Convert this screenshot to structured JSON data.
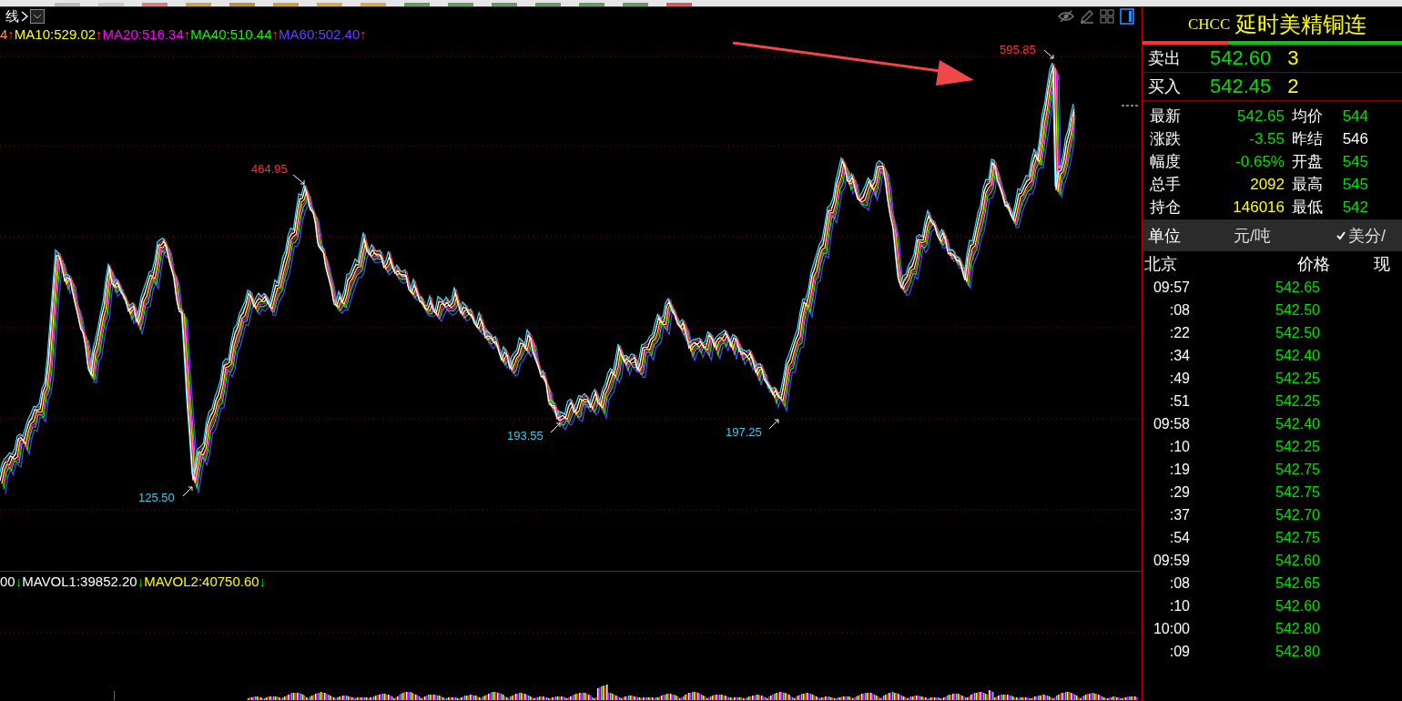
{
  "chart": {
    "period_label": "线",
    "ma_legend": [
      {
        "value": "4",
        "color": "#ff9a30",
        "arrow": "↑",
        "rising": true
      },
      {
        "value": "MA10:529.02",
        "color": "#ffff00",
        "arrow": "↑",
        "rising": true
      },
      {
        "value": "MA20:516.34",
        "color": "#ff00ff",
        "arrow": "↑",
        "rising": true
      },
      {
        "value": "MA40:510.44",
        "color": "#00ff00",
        "arrow": "↑",
        "rising": true
      },
      {
        "value": "MA60:502.40",
        "color": "#6a3cff",
        "arrow": "↑",
        "rising": true
      }
    ],
    "peak_labels": [
      {
        "text": "464.95",
        "color": "#ff3030"
      },
      {
        "text": "125.50",
        "color": "#40c8e8"
      },
      {
        "text": "193.55",
        "color": "#40c8e8"
      },
      {
        "text": "197.25",
        "color": "#40c8e8"
      },
      {
        "text": "595.85",
        "color": "#ff3030"
      }
    ],
    "volume_legend": [
      {
        "value": "00",
        "color": "#ffffff",
        "arrow": "↓",
        "rising": false
      },
      {
        "value": "MAVOL1:39852.20",
        "color": "#ffffff",
        "arrow": "↓",
        "rising": false
      },
      {
        "value": "MAVOL2:40750.60",
        "color": "#ffff00",
        "arrow": "↓",
        "rising": false
      }
    ]
  },
  "quote": {
    "code": "CHCC",
    "name": "延时美精铜连",
    "ratio": {
      "level": 0.33
    },
    "sell": {
      "label": "卖出",
      "price": "542.60",
      "qty": "3"
    },
    "buy": {
      "label": "买入",
      "price": "542.45",
      "qty": "2"
    },
    "stats": [
      {
        "label": "最新",
        "value": "542.65",
        "color": "#00e000"
      },
      {
        "label": "均价",
        "value": "544",
        "color": "#00e000"
      },
      {
        "label": "涨跌",
        "value": "-3.55",
        "color": "#00e000"
      },
      {
        "label": "昨结",
        "value": "546",
        "color": "#ffffff"
      },
      {
        "label": "幅度",
        "value": "-0.65%",
        "color": "#00e000"
      },
      {
        "label": "开盘",
        "value": "545",
        "color": "#00e000"
      },
      {
        "label": "总手",
        "value": "2092",
        "color": "#ffff00"
      },
      {
        "label": "最高",
        "value": "545",
        "color": "#00e000"
      },
      {
        "label": "持仓",
        "value": "146016",
        "color": "#ffff00"
      },
      {
        "label": "最低",
        "value": "542",
        "color": "#00e000"
      }
    ],
    "unit": {
      "label": "单位",
      "options": [
        {
          "label": "元/吨",
          "checked": false
        },
        {
          "label": "美分/",
          "checked": true
        }
      ]
    },
    "ticks": {
      "columns": [
        "北京",
        "价格",
        "现"
      ],
      "rows": [
        {
          "time": "09:57",
          "price": "542.65"
        },
        {
          "time": ":08",
          "price": "542.50"
        },
        {
          "time": ":22",
          "price": "542.50"
        },
        {
          "time": ":34",
          "price": "542.40"
        },
        {
          "time": ":49",
          "price": "542.25"
        },
        {
          "time": ":51",
          "price": "542.25"
        },
        {
          "time": "09:58",
          "price": "542.40"
        },
        {
          "time": ":10",
          "price": "542.25"
        },
        {
          "time": ":19",
          "price": "542.75"
        },
        {
          "time": ":29",
          "price": "542.75"
        },
        {
          "time": ":37",
          "price": "542.70"
        },
        {
          "time": ":54",
          "price": "542.75"
        },
        {
          "time": "09:59",
          "price": "542.60"
        },
        {
          "time": ":08",
          "price": "542.65"
        },
        {
          "time": ":10",
          "price": "542.60"
        },
        {
          "time": "10:00",
          "price": "542.80"
        },
        {
          "time": ":09",
          "price": "542.80"
        }
      ]
    }
  }
}
